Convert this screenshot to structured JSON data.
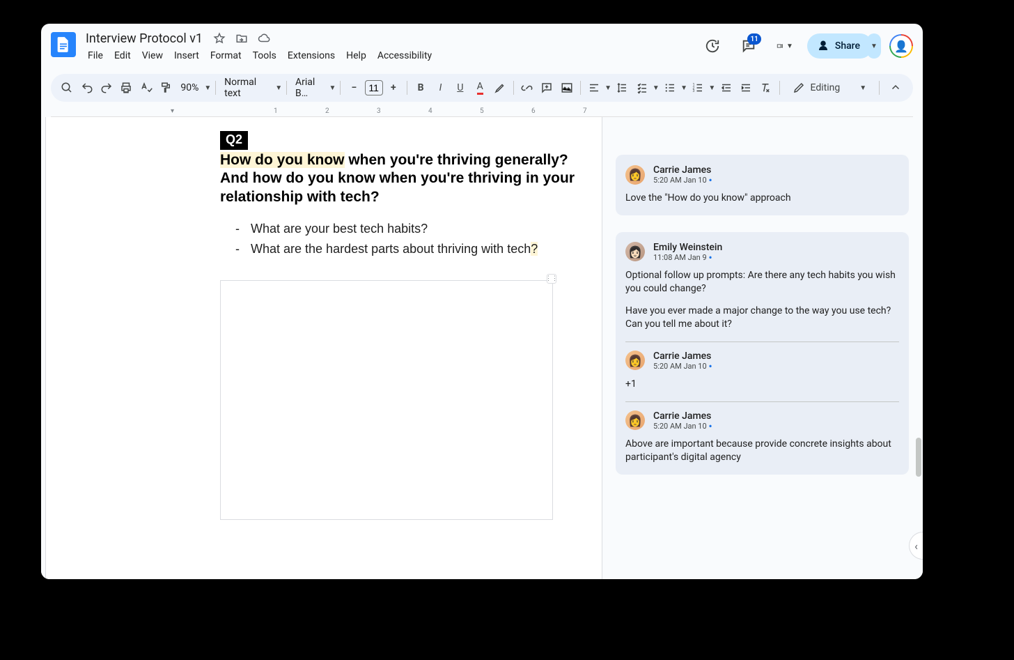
{
  "doc": {
    "title": "Interview Protocol v1"
  },
  "menu": {
    "items": [
      "File",
      "Edit",
      "View",
      "Insert",
      "Format",
      "Tools",
      "Extensions",
      "Help",
      "Accessibility"
    ]
  },
  "header": {
    "comment_badge": "11",
    "share_label": "Share"
  },
  "toolbar": {
    "zoom": "90%",
    "style": "Normal text",
    "font": "Arial B…",
    "font_size": "11",
    "mode": "Editing"
  },
  "ruler": {
    "marks": [
      "1",
      "2",
      "3",
      "4",
      "5",
      "6",
      "7"
    ]
  },
  "content": {
    "q_badge": "Q2",
    "heading_highlight": "How do you know",
    "heading_rest": " when you're thriving generally? And how do you know when you're thriving in your relationship with tech?",
    "bullets": [
      {
        "text": "What are your best tech habits?",
        "highlight": ""
      },
      {
        "text": "What are the hardest parts about thriving with tech",
        "highlight": "?"
      }
    ]
  },
  "comments": [
    {
      "author": "Carrie James",
      "time": "5:20 AM Jan 10",
      "avatar": "cj",
      "body": [
        "Love the \"How do you know\" approach"
      ],
      "replies": []
    },
    {
      "author": "Emily Weinstein",
      "time": "11:08 AM Jan 9",
      "avatar": "ew",
      "body": [
        "Optional follow up prompts: Are there any tech habits you wish you could change?",
        "Have you ever made a major change to the way you use tech? Can you tell me about it?"
      ],
      "replies": [
        {
          "author": "Carrie James",
          "time": "5:20 AM Jan 10",
          "avatar": "cj",
          "body": [
            "+1"
          ]
        },
        {
          "author": "Carrie James",
          "time": "5:20 AM Jan 10",
          "avatar": "cj",
          "body": [
            "Above are important because provide concrete insights about participant's digital agency"
          ]
        }
      ]
    }
  ]
}
